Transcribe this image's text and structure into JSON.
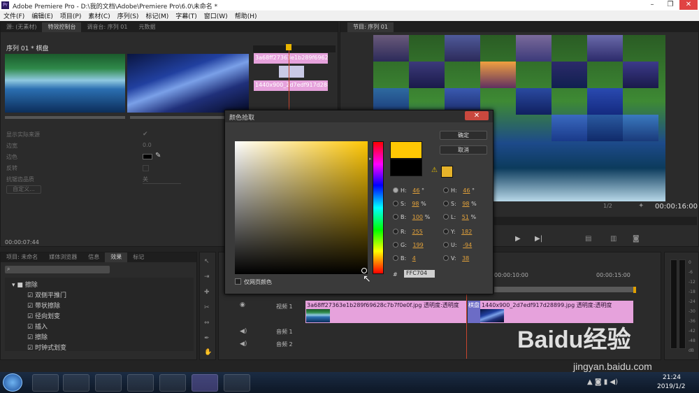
{
  "window": {
    "title": "Adobe Premiere Pro - D:\\我的文档\\Adobe\\Premiere Pro\\6.0\\未命名 *",
    "app_icon": "Pr"
  },
  "menu": [
    "文件(F)",
    "编辑(E)",
    "项目(P)",
    "素材(C)",
    "序列(S)",
    "标记(M)",
    "字幕(T)",
    "窗口(W)",
    "帮助(H)"
  ],
  "source_panel": {
    "tabs": [
      "源: (无素材)",
      "特效控制台",
      "调音台: 序列 01",
      "元数据"
    ],
    "sequence_label": "序列 01 * 棋盘",
    "clip1_name": "3a68ff27363e1b289f69628c",
    "clip2_name": "1440x900_2d7edf917d28899",
    "props": [
      {
        "label": "显示实际来源"
      },
      {
        "label": "边宽",
        "value": "0.0"
      },
      {
        "label": "边色"
      },
      {
        "label": "反转"
      },
      {
        "label": "抗锯齿品质",
        "value": "关"
      }
    ],
    "custom_btn": "自定义...",
    "timecode": "00:00:07:44"
  },
  "program_panel": {
    "tab": "节目: 序列 01",
    "zoom": "1/2",
    "timecode": "00:00:16:00"
  },
  "effects_panel": {
    "tabs": [
      "项目: 未命名",
      "媒体浏览器",
      "信息",
      "效果",
      "标记"
    ],
    "search_placeholder": "",
    "folder": "擦除",
    "items": [
      "双侧平推门",
      "带状擦除",
      "径向划变",
      "插入",
      "擦除",
      "时钟式划变"
    ]
  },
  "dialog": {
    "title": "颜色拾取",
    "ok": "确定",
    "cancel": "取消",
    "web_only": "仅网页颜色",
    "new_color": "#ffc704",
    "old_color": "#000000",
    "gamut_color": "#e6b32a",
    "fields_left": [
      {
        "k": "H:",
        "v": "46",
        "u": "°"
      },
      {
        "k": "S:",
        "v": "98",
        "u": "%"
      },
      {
        "k": "B:",
        "v": "100",
        "u": "%"
      },
      {
        "k": "R:",
        "v": "255",
        "u": ""
      },
      {
        "k": "G:",
        "v": "199",
        "u": ""
      },
      {
        "k": "B:",
        "v": "4",
        "u": ""
      }
    ],
    "fields_right": [
      {
        "k": "H:",
        "v": "46",
        "u": "°"
      },
      {
        "k": "S:",
        "v": "98",
        "u": "%"
      },
      {
        "k": "L:",
        "v": "51",
        "u": "%"
      },
      {
        "k": "Y:",
        "v": "182",
        "u": ""
      },
      {
        "k": "U:",
        "v": "-94",
        "u": ""
      },
      {
        "k": "V:",
        "v": "38",
        "u": ""
      }
    ],
    "hex_label": "#",
    "hex": "FFC704"
  },
  "timeline": {
    "ruler": [
      "00:00:10:00",
      "00:00:15:00"
    ],
    "tracks": [
      "视频 1",
      "音频 1",
      "音频 2"
    ],
    "clipA": "3a68ff27363e1b289f69628c7b7f0e0f.jpg",
    "clipA_effect": "透明度:透明度",
    "transition": "棋盘",
    "clipB": "1440x900_2d7edf917d28899.jpg",
    "clipB_effect": "透明度:透明度"
  },
  "meter_labels": [
    "0",
    "-6",
    "-12",
    "-18",
    "-24",
    "-30",
    "-36",
    "-42",
    "-48",
    "dB"
  ],
  "watermark": {
    "brand": "Baidu经验",
    "url": "jingyan.baidu.com"
  },
  "taskbar": {
    "time": "21:24",
    "date": "2019/1/2"
  }
}
